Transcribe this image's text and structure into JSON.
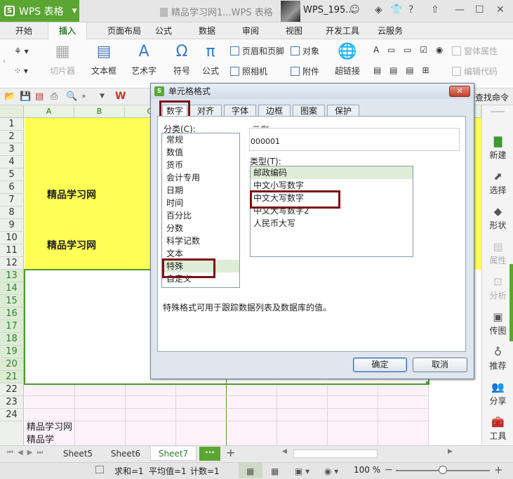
{
  "app": {
    "name": "WPS 表格",
    "doc_title": "精品学习网1...WPS 表格",
    "user": "WPS_195..."
  },
  "menu_tabs": [
    "开始",
    "插入",
    "页面布局",
    "公式",
    "数据",
    "审阅",
    "视图",
    "开发工具",
    "云服务"
  ],
  "ribbon": {
    "clipart": "切片器",
    "textbox": "文本框",
    "wordart": "艺术字",
    "symbol": "符号",
    "formula": "公式",
    "header_footer": "页眉和页脚",
    "object": "对象",
    "camera": "照相机",
    "attachment": "附件",
    "hyperlink": "超链接",
    "control_props": "窗体属性",
    "edit_code": "编辑代码",
    "find_command": "查找命令"
  },
  "grid": {
    "columns": [
      "A",
      "B",
      "C"
    ],
    "rows": [
      "1",
      "2",
      "3",
      "4",
      "5",
      "6",
      "7",
      "8",
      "9",
      "10",
      "11",
      "12",
      "13",
      "14",
      "15",
      "16",
      "17",
      "18",
      "19",
      "20",
      "21",
      "22",
      "23",
      "24"
    ],
    "cell_a7": "精品学习网",
    "cell_a10": "精品学习网",
    "cell_a25": "精品学习网精品学"
  },
  "sidebar": [
    "新建",
    "选择",
    "形状",
    "属性",
    "分析",
    "传图",
    "推荐",
    "分享",
    "工具"
  ],
  "sheets": [
    "Sheet5",
    "Sheet6",
    "Sheet7"
  ],
  "status": {
    "sum": "求和=1",
    "avg": "平均值=1",
    "count": "计数=1",
    "zoom": "100 %"
  },
  "dialog": {
    "title": "单元格格式",
    "tabs": [
      "数字",
      "对齐",
      "字体",
      "边框",
      "图案",
      "保护"
    ],
    "category_label": "分类(C):",
    "categories": [
      "常规",
      "数值",
      "货币",
      "会计专用",
      "日期",
      "时间",
      "百分比",
      "分数",
      "科学记数",
      "文本",
      "特殊",
      "自定义"
    ],
    "selected_category": "特殊",
    "sample_label": "示例",
    "sample_value": "000001",
    "type_label": "类型(T):",
    "types": [
      "邮政编码",
      "中文小写数字",
      "中文大写数字",
      "中文大写数字2",
      "人民币大写"
    ],
    "description": "特殊格式可用于跟踪数据列表及数据库的值。",
    "ok": "确定",
    "cancel": "取消"
  }
}
